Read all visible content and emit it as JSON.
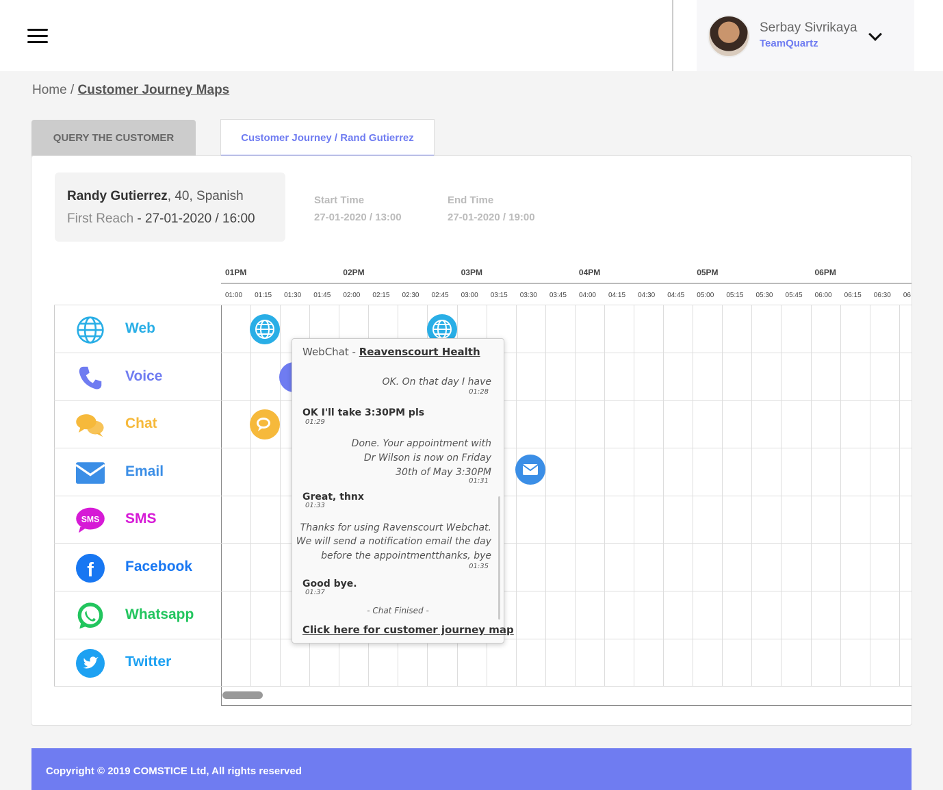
{
  "header": {
    "user_name": "Serbay Sivrikaya",
    "team": "TeamQuartz"
  },
  "breadcrumb": {
    "home": "Home",
    "separator": "/",
    "current": "Customer Journey Maps"
  },
  "tabs": [
    {
      "label": "QUERY THE CUSTOMER"
    },
    {
      "label": "Customer Journey / Rand Gutierrez"
    }
  ],
  "customer": {
    "name": "Randy Gutierrez",
    "details": ", 40, Spanish",
    "first_reach_label": "First Reach",
    "first_reach_value": " - 27-01-2020 / 16:00"
  },
  "times": {
    "start_label": "Start Time",
    "start_value": "27-01-2020 / 13:00",
    "end_label": "End Time",
    "end_value": "27-01-2020 / 19:00"
  },
  "timeline": {
    "hours": [
      "01PM",
      "02PM",
      "03PM",
      "04PM",
      "05PM",
      "06PM"
    ],
    "quarters": [
      "01:00",
      "01:15",
      "01:30",
      "01:45",
      "02:00",
      "02:15",
      "02:30",
      "02:45",
      "03:00",
      "03:15",
      "03:30",
      "03:45",
      "04:00",
      "04:15",
      "04:30",
      "04:45",
      "05:00",
      "05:15",
      "05:30",
      "05:45",
      "06:00",
      "06:15",
      "06:30",
      "06"
    ]
  },
  "channels": [
    {
      "label": "Web",
      "color": "#29aee6",
      "icon": "globe-icon"
    },
    {
      "label": "Voice",
      "color": "#6f7cf1",
      "icon": "phone-icon"
    },
    {
      "label": "Chat",
      "color": "#f6b93b",
      "icon": "chat-icon"
    },
    {
      "label": "Email",
      "color": "#3b8ee6",
      "icon": "envelope-icon"
    },
    {
      "label": "SMS",
      "color": "#d61ad6",
      "icon": "sms-icon",
      "icon_text": "SMS"
    },
    {
      "label": "Facebook",
      "color": "#1877f2",
      "icon": "facebook-icon",
      "icon_text": "f"
    },
    {
      "label": "Whatsapp",
      "color": "#22c55e",
      "icon": "whatsapp-icon"
    },
    {
      "label": "Twitter",
      "color": "#1da1f2",
      "icon": "twitter-icon"
    }
  ],
  "popup": {
    "prefix": "WebChat - ",
    "company": "Reavenscourt Health",
    "messages": [
      {
        "side": "r",
        "lines": [
          "OK. On that day I have"
        ],
        "time": "01:28"
      },
      {
        "side": "l",
        "lines": [
          "OK I'll take 3:30PM pls"
        ],
        "time": "01:29"
      },
      {
        "side": "r",
        "lines": [
          "Done. Your appointment with",
          "Dr Wilson is now on Friday",
          "30th of May 3:30PM"
        ],
        "time": "01:31"
      },
      {
        "side": "l",
        "lines": [
          "Great, thnx"
        ],
        "time": "01:33"
      },
      {
        "side": "r",
        "lines": [
          "Thanks for using Ravenscourt Webchat.",
          "We will send a notification email the day",
          "before the appointmentthanks, bye"
        ],
        "time": "01:35"
      },
      {
        "side": "l",
        "lines": [
          "Good bye."
        ],
        "time": "01:37"
      }
    ],
    "end_text": "- Chat Finised -",
    "link": "Click here for customer journey map"
  },
  "footer": {
    "text": "Copyright © 2019 COMSTICE Ltd, All rights reserved"
  }
}
